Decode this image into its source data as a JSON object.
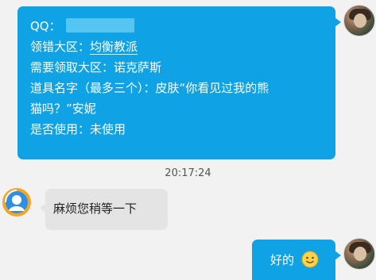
{
  "conversation": {
    "order_message": {
      "qq_label": "QQ：",
      "region_label": "领错大区：",
      "region_value": "均衡教派",
      "target_label": "需要领取大区：",
      "target_value": "诺克萨斯",
      "item_line_1": "道具名字（最多三个）：皮肤“你看见过我的熊",
      "item_line_2": "猫吗？”安妮",
      "used_label": "是否使用：",
      "used_value": "未使用"
    },
    "timestamp": "20:17:24",
    "agent_message": "麻烦您稍等一下",
    "user_reply": "好的"
  },
  "colors": {
    "user_bubble": "#0fa3e6",
    "agent_bubble": "#e4e4e4",
    "background": "#f2f2f2"
  },
  "icons": {
    "agent_avatar": "customer-service-icon",
    "user_avatar": "user-avatar",
    "emoji": "smile-emoji-icon"
  }
}
